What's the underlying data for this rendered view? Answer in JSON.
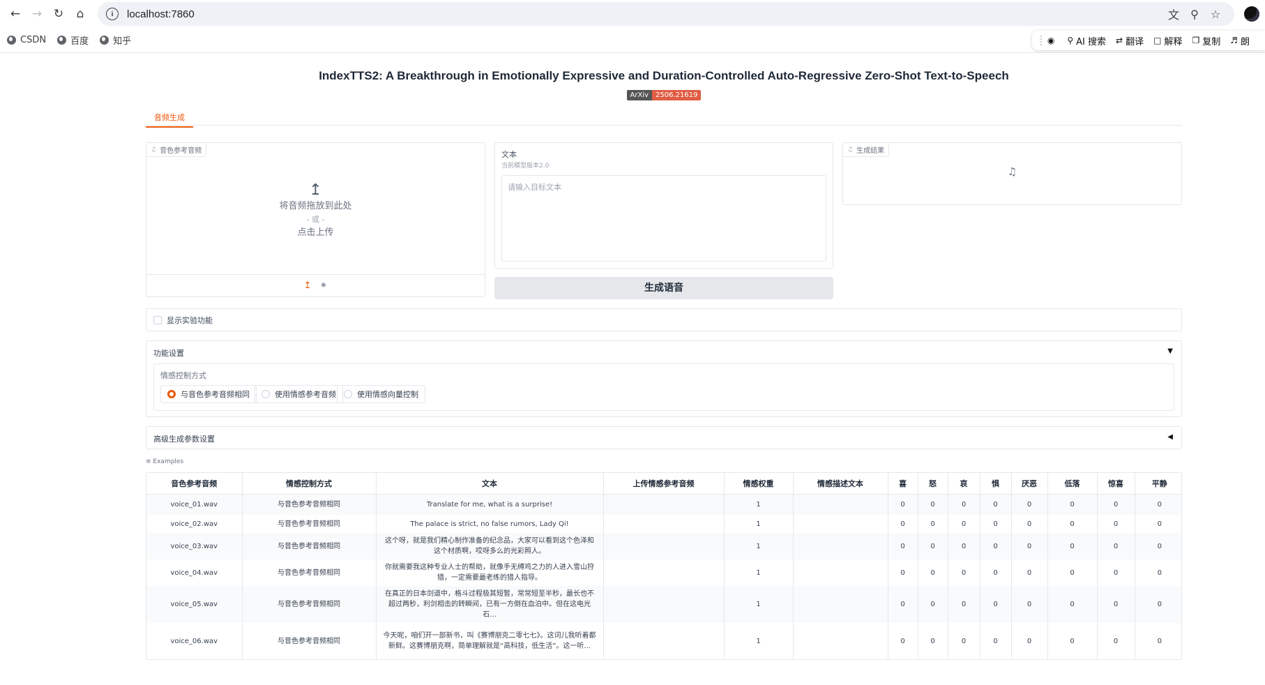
{
  "browser": {
    "url": "localhost:7860",
    "bookmarks": [
      "CSDN",
      "百度",
      "知乎"
    ],
    "extension_bar": {
      "items": [
        "AI 搜索",
        "翻译",
        "解释",
        "复制",
        "朗"
      ]
    }
  },
  "app": {
    "title": "IndexTTS2: A Breakthrough in Emotionally Expressive and Duration-Controlled Auto-Regressive Zero-Shot Text-to-Speech",
    "badge_left": "ArXiv",
    "badge_right": "2506.21619",
    "tab": "音频生成",
    "ref_audio": {
      "label": "音色参考音频",
      "drop_text": "将音频拖放到此处",
      "or_text": "- 或 -",
      "click_text": "点击上传"
    },
    "text_input": {
      "label": "文本",
      "info": "当前模型版本2.0",
      "placeholder": "请输入目标文本"
    },
    "generate_button": "生成语音",
    "result": {
      "label": "生成结果"
    },
    "experimental_checkbox": "显示实验功能",
    "feature_settings": {
      "title": "功能设置",
      "emotion_control_label": "情感控制方式",
      "options": [
        "与音色参考音频相同",
        "使用情感参考音频",
        "使用情感向量控制"
      ],
      "selected_index": 0
    },
    "advanced_settings": {
      "title": "高级生成参数设置"
    },
    "examples": {
      "label": "Examples",
      "headers": [
        "音色参考音频",
        "情感控制方式",
        "文本",
        "上传情感参考音频",
        "情感权重",
        "情感描述文本",
        "喜",
        "怒",
        "哀",
        "惧",
        "厌恶",
        "低落",
        "惊喜",
        "平静"
      ],
      "rows": [
        [
          "voice_01.wav",
          "与音色参考音频相同",
          "Translate for me, what is a surprise!",
          "",
          "1",
          "",
          "0",
          "0",
          "0",
          "0",
          "0",
          "0",
          "0",
          "0"
        ],
        [
          "voice_02.wav",
          "与音色参考音频相同",
          "The palace is strict, no false rumors, Lady Qi!",
          "",
          "1",
          "",
          "0",
          "0",
          "0",
          "0",
          "0",
          "0",
          "0",
          "0"
        ],
        [
          "voice_03.wav",
          "与音色参考音频相同",
          "这个呀，就是我们精心制作准备的纪念品，大家可以看到这个色泽和这个材质啊，哎呀多么的光彩照人。",
          "",
          "1",
          "",
          "0",
          "0",
          "0",
          "0",
          "0",
          "0",
          "0",
          "0"
        ],
        [
          "voice_04.wav",
          "与音色参考音频相同",
          "你就需要我这种专业人士的帮助，就像手无缚鸡之力的人进入雪山狩猎，一定需要最老练的猎人指导。",
          "",
          "1",
          "",
          "0",
          "0",
          "0",
          "0",
          "0",
          "0",
          "0",
          "0"
        ],
        [
          "voice_05.wav",
          "与音色参考音频相同",
          "在真正的日本剑道中，格斗过程极其短暂，常常短至半秒，最长也不超过两秒，利剑相击的转瞬间，已有一方倒在血泊中。但在这电光石...",
          "",
          "1",
          "",
          "0",
          "0",
          "0",
          "0",
          "0",
          "0",
          "0",
          "0"
        ],
        [
          "voice_06.wav",
          "与音色参考音频相同",
          "今天呢，咱们开一部新书，叫《赛博朋克二零七七》。这词儿我听着都新鲜。这赛博朋克啊，简单理解就是“高科技，低生活”。这一听...",
          "",
          "1",
          "",
          "0",
          "0",
          "0",
          "0",
          "0",
          "0",
          "0",
          "0"
        ]
      ]
    }
  }
}
